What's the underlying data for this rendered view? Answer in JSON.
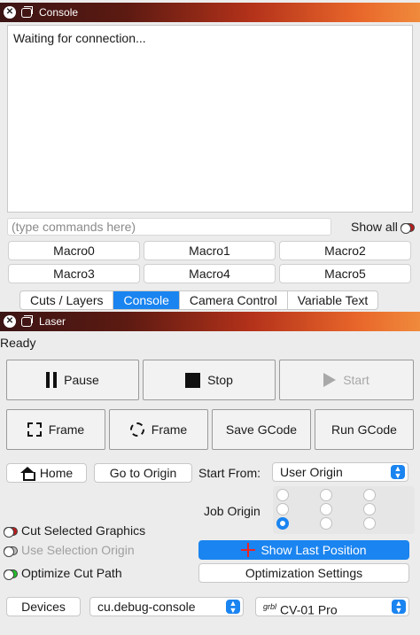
{
  "console_window": {
    "title": "Console"
  },
  "console": {
    "output": "Waiting for connection...",
    "input_placeholder": "(type commands here)",
    "show_all_label": "Show all"
  },
  "macros": [
    "Macro0",
    "Macro1",
    "Macro2",
    "Macro3",
    "Macro4",
    "Macro5"
  ],
  "tabs": [
    {
      "label": "Cuts / Layers"
    },
    {
      "label": "Console"
    },
    {
      "label": "Camera Control"
    },
    {
      "label": "Variable Text"
    }
  ],
  "laser_window": {
    "title": "Laser"
  },
  "laser": {
    "status": "Ready",
    "pause_label": "Pause",
    "stop_label": "Stop",
    "start_label": "Start",
    "frame_rect_label": "Frame",
    "frame_round_label": "Frame",
    "save_gcode_label": "Save GCode",
    "run_gcode_label": "Run GCode",
    "home_label": "Home",
    "go_to_origin_label": "Go to Origin",
    "start_from_label": "Start From:",
    "start_from_value": "User Origin",
    "job_origin_label": "Job Origin",
    "cut_selected_label": "Cut Selected Graphics",
    "use_selection_origin_label": "Use Selection Origin",
    "optimize_cut_path_label": "Optimize Cut Path",
    "show_last_position_label": "Show Last Position",
    "optimization_settings_label": "Optimization Settings",
    "devices_label": "Devices",
    "port_value": "cu.debug-console",
    "device_brand": "grbl",
    "device_value": "CV-01 Pro"
  },
  "colors": {
    "accent": "#1a84f0",
    "toggle_on": "#b81c1c",
    "toggle_green": "#22c02a"
  }
}
